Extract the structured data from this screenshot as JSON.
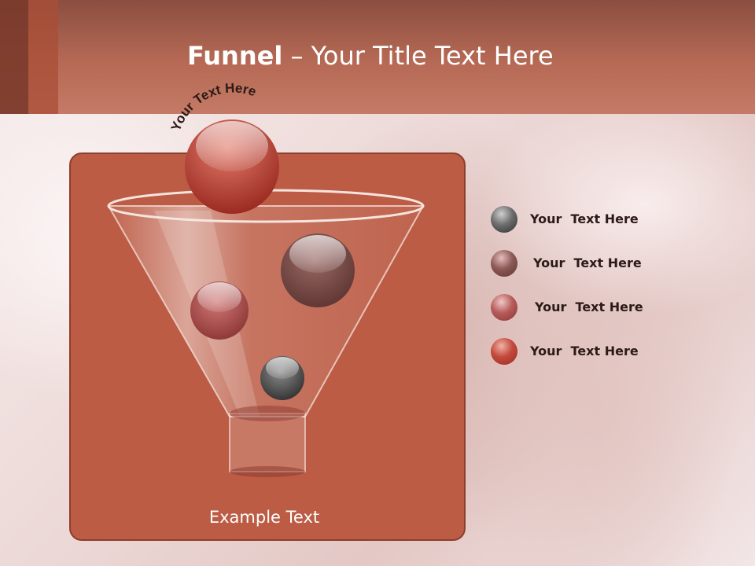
{
  "slide": {
    "title_bold": "Funnel",
    "title_rest": " – Your Title Text Here",
    "arc_text": "Your Text Here",
    "example_text": "Example Text"
  },
  "legend": {
    "items": [
      {
        "label": "Your  Text Here",
        "color": "#4a4a4a"
      },
      {
        "label": "Your  Text Here",
        "color": "#7a4a4a"
      },
      {
        "label": "Your  Text Here",
        "color": "#a8514f"
      },
      {
        "label": "Your  Text Here",
        "color": "#b33a2f"
      }
    ]
  },
  "colors": {
    "header": "#b66a55",
    "panel": "#bc5c45",
    "accent_dark": "#7a3a2b"
  }
}
